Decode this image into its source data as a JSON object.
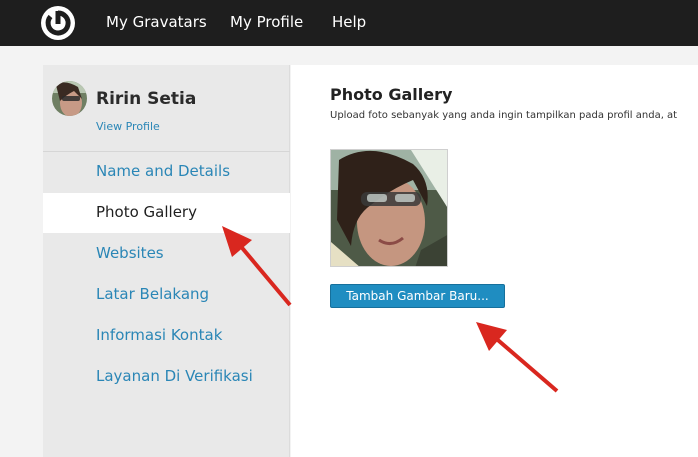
{
  "header": {
    "logo_icon": "gravatar-logo-icon",
    "nav": [
      {
        "label": "My Gravatars"
      },
      {
        "label": "My Profile"
      },
      {
        "label": "Help"
      }
    ]
  },
  "sidebar": {
    "profile": {
      "name": "Ririn Setia",
      "view_profile_label": "View Profile"
    },
    "items": [
      {
        "label": "Name and Details",
        "active": false
      },
      {
        "label": "Photo Gallery",
        "active": true
      },
      {
        "label": "Websites",
        "active": false
      },
      {
        "label": "Latar Belakang",
        "active": false
      },
      {
        "label": "Informasi Kontak",
        "active": false
      },
      {
        "label": "Layanan Di Verifikasi",
        "active": false
      }
    ]
  },
  "main": {
    "title": "Photo Gallery",
    "description": "Upload foto sebanyak yang anda ingin tampilkan pada profil anda, at",
    "add_button_label": "Tambah Gambar Baru..."
  },
  "colors": {
    "topbar": "#1e1e1e",
    "link": "#2a86b6",
    "button": "#1f8dc1",
    "annotation_arrow": "#d9271f"
  }
}
